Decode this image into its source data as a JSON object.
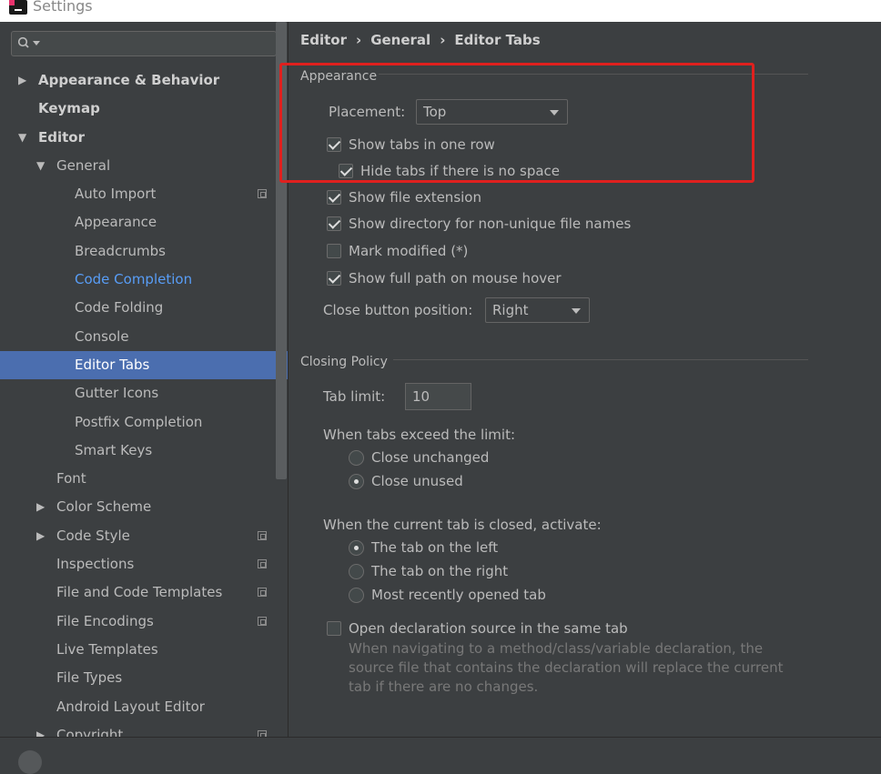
{
  "window": {
    "title": "Settings"
  },
  "sidebar": {
    "items": [
      {
        "label": "Appearance & Behavior",
        "level": 0,
        "arrow": "right",
        "bold": true
      },
      {
        "label": "Keymap",
        "level": 0,
        "arrow": "",
        "bold": true
      },
      {
        "label": "Editor",
        "level": 0,
        "arrow": "down",
        "bold": true
      },
      {
        "label": "General",
        "level": 1,
        "arrow": "down"
      },
      {
        "label": "Auto Import",
        "level": 2,
        "icon": true
      },
      {
        "label": "Appearance",
        "level": 2
      },
      {
        "label": "Breadcrumbs",
        "level": 2
      },
      {
        "label": "Code Completion",
        "level": 2,
        "link": true
      },
      {
        "label": "Code Folding",
        "level": 2
      },
      {
        "label": "Console",
        "level": 2
      },
      {
        "label": "Editor Tabs",
        "level": 2,
        "selected": true
      },
      {
        "label": "Gutter Icons",
        "level": 2
      },
      {
        "label": "Postfix Completion",
        "level": 2
      },
      {
        "label": "Smart Keys",
        "level": 2
      },
      {
        "label": "Font",
        "level": 1
      },
      {
        "label": "Color Scheme",
        "level": 1,
        "arrow": "right"
      },
      {
        "label": "Code Style",
        "level": 1,
        "arrow": "right",
        "icon": true
      },
      {
        "label": "Inspections",
        "level": 1,
        "icon": true
      },
      {
        "label": "File and Code Templates",
        "level": 1,
        "icon": true
      },
      {
        "label": "File Encodings",
        "level": 1,
        "icon": true
      },
      {
        "label": "Live Templates",
        "level": 1
      },
      {
        "label": "File Types",
        "level": 1
      },
      {
        "label": "Android Layout Editor",
        "level": 1
      },
      {
        "label": "Copyright",
        "level": 1,
        "arrow": "right",
        "icon": true
      }
    ]
  },
  "breadcrumb": [
    "Editor",
    "General",
    "Editor Tabs"
  ],
  "appearance": {
    "group_title": "Appearance",
    "placement_label": "Placement:",
    "placement_value": "Top",
    "show_tabs_one_row": "Show tabs in one row",
    "hide_tabs_no_space": "Hide tabs if there is no space",
    "show_file_extension": "Show file extension",
    "show_directory": "Show directory for non-unique file names",
    "mark_modified": "Mark modified (*)",
    "show_full_path": "Show full path on mouse hover",
    "close_button_label": "Close button position:",
    "close_button_value": "Right"
  },
  "closing": {
    "group_title": "Closing Policy",
    "tab_limit_label": "Tab limit:",
    "tab_limit_value": "10",
    "exceed_label": "When tabs exceed the limit:",
    "close_unchanged": "Close unchanged",
    "close_unused": "Close unused",
    "activate_label": "When the current tab is closed, activate:",
    "tab_left": "The tab on the left",
    "tab_right": "The tab on the right",
    "most_recent": "Most recently opened tab",
    "open_declaration": "Open declaration source in the same tab",
    "hint": "When navigating to a method/class/variable declaration, the source file that contains the declaration will replace the current tab if there are no changes."
  }
}
